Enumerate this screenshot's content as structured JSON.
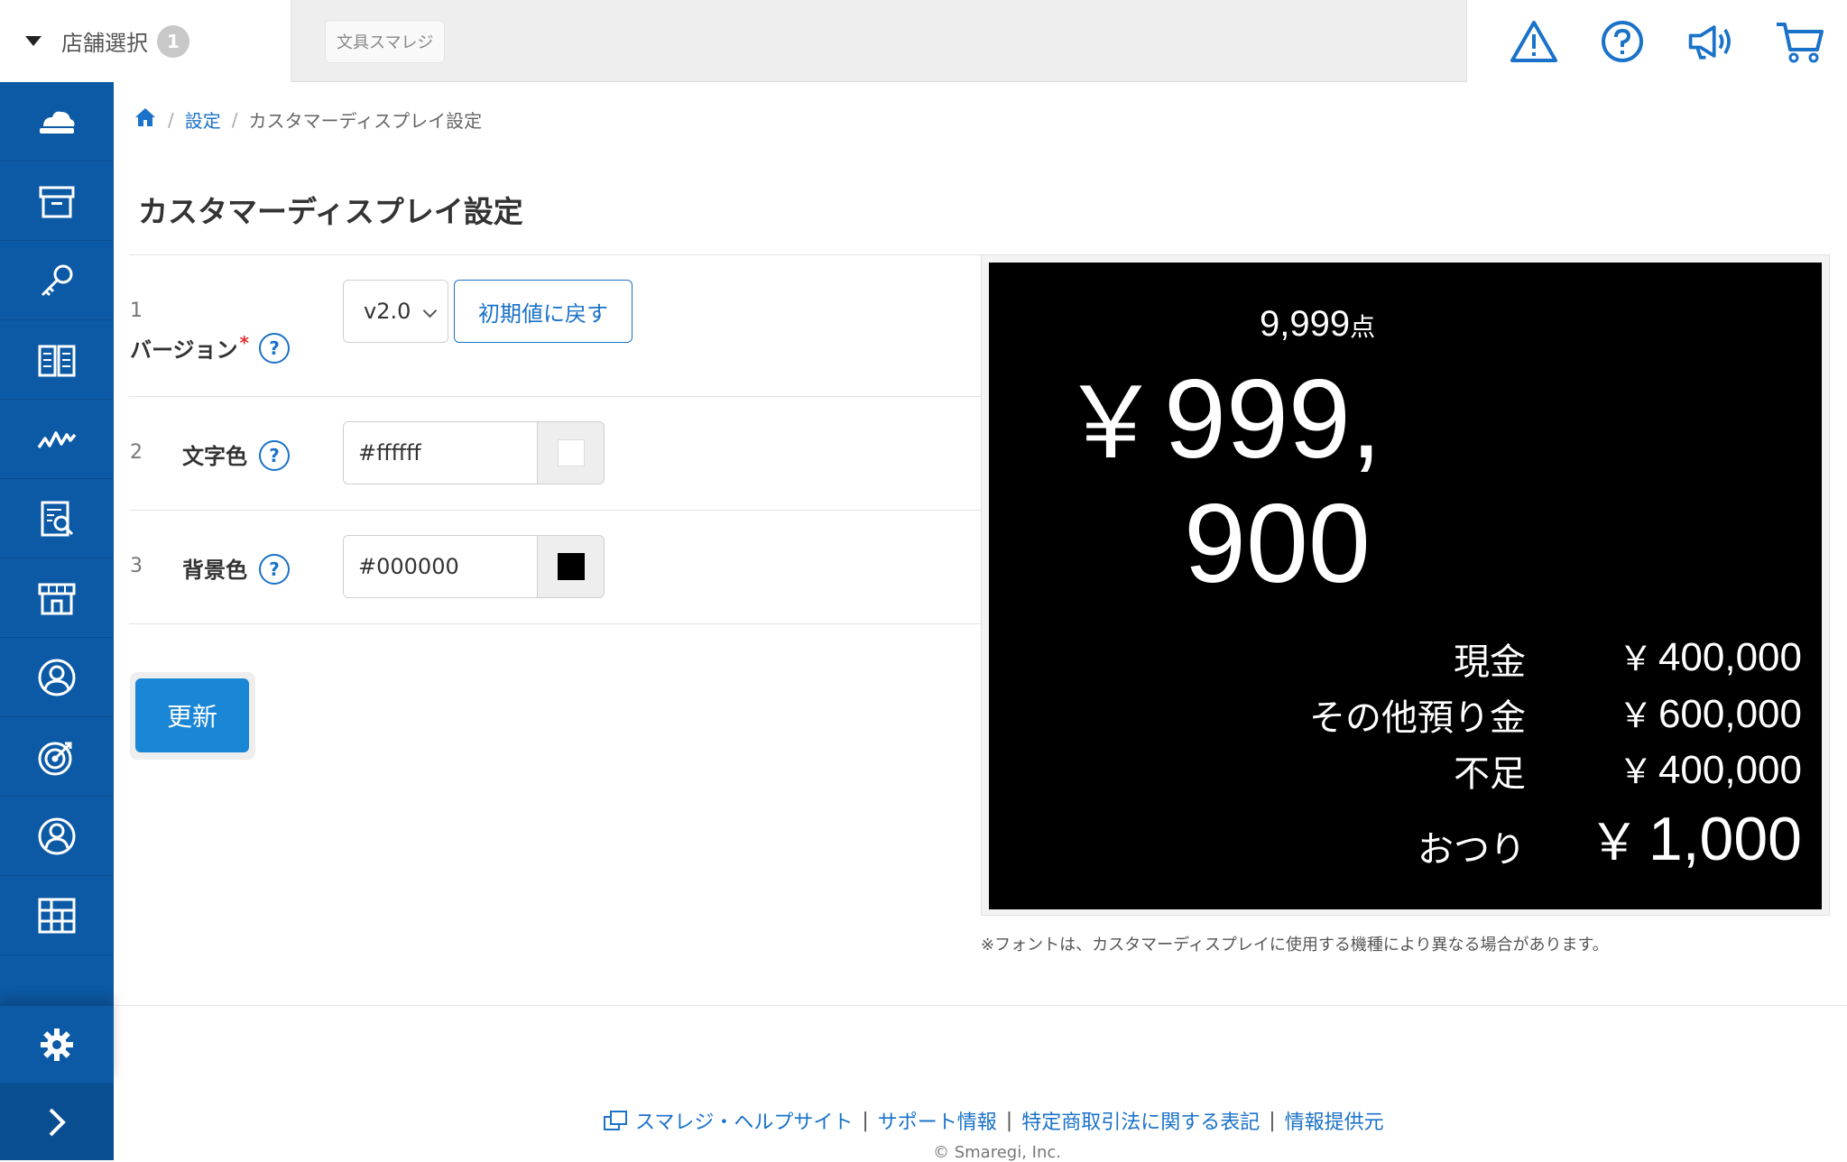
{
  "header": {
    "store_select_label": "店舗選択",
    "store_count": "1",
    "store_name": "文具スマレジ",
    "icons": [
      "warning-icon",
      "help-icon",
      "megaphone-icon",
      "cart-icon"
    ]
  },
  "sidebar": {
    "items": [
      "cloud-icon",
      "archive-icon",
      "key-icon",
      "book-icon",
      "chart-icon",
      "report-icon",
      "store-icon",
      "customer-icon",
      "target-icon",
      "user-icon",
      "apps-icon"
    ],
    "settings_icon": "gear-icon",
    "expand_icon": "chevron-right-icon"
  },
  "breadcrumb": {
    "home_icon": "home-icon",
    "settings": "設定",
    "current": "カスタマーディスプレイ設定"
  },
  "page": {
    "title": "カスタマーディスプレイ設定"
  },
  "form": {
    "version": {
      "num": "1",
      "label": "バージョン",
      "required": "*",
      "help": "?",
      "selected": "v2.0",
      "reset_label": "初期値に戻す"
    },
    "text_color": {
      "num": "2",
      "label": "文字色",
      "help": "?",
      "value": "#ffffff"
    },
    "bg_color": {
      "num": "3",
      "label": "背景色",
      "help": "?",
      "value": "#000000"
    },
    "update_label": "更新"
  },
  "preview": {
    "count": "9,999",
    "count_unit": "点",
    "total_yen": "￥",
    "total_line1": "999,",
    "total_line2": "900",
    "rows": [
      {
        "label": "現金",
        "yen": "￥",
        "value": "400,000"
      },
      {
        "label": "その他預り金",
        "yen": "￥",
        "value": "600,000"
      },
      {
        "label": "不足",
        "yen": "￥",
        "value": "400,000"
      }
    ],
    "change_label": "おつり",
    "change_yen": "￥",
    "change_value": "1,000",
    "note": "※フォントは、カスタマーディスプレイに使用する機種により異なる場合があります。"
  },
  "footer": {
    "help_site": "スマレジ・ヘルプサイト",
    "support": "サポート情報",
    "law": "特定商取引法に関する表記",
    "provider": "情報提供元",
    "copyright": "© Smaregi, Inc."
  },
  "colors": {
    "accent": "#1a72c9",
    "sidebar": "#0c5aa6",
    "primary_button": "#1a86d6"
  }
}
